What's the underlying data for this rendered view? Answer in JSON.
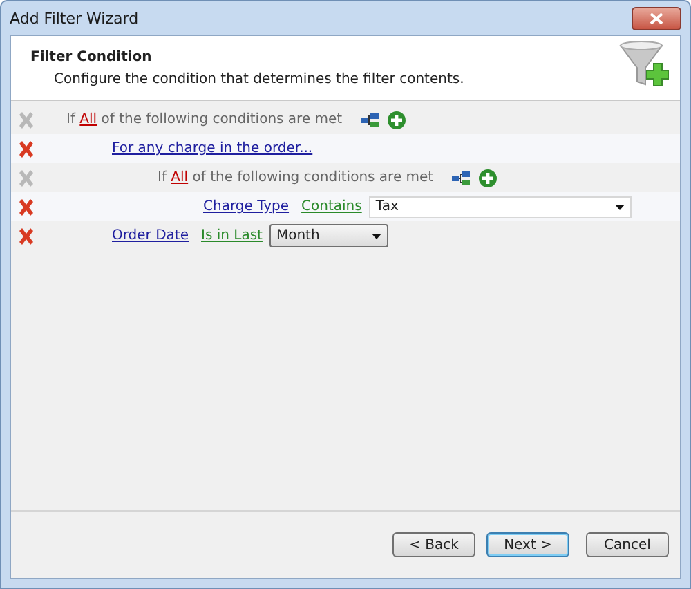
{
  "window": {
    "title": "Add Filter Wizard"
  },
  "header": {
    "title": "Filter Condition",
    "description": "Configure the condition that determines the filter contents."
  },
  "conditions": [
    {
      "kind": "group",
      "remove_disabled": true,
      "prefix": "If",
      "quantifier": "All",
      "suffix": "of the following conditions are met",
      "children": [
        {
          "kind": "link",
          "remove_disabled": false,
          "label": "For any charge in the order...",
          "children": [
            {
              "kind": "group",
              "remove_disabled": true,
              "prefix": "If",
              "quantifier": "All",
              "suffix": "of the following conditions are met",
              "children": [
                {
                  "kind": "condition",
                  "remove_disabled": false,
                  "field": "Charge Type",
                  "operator": "Contains",
                  "value": {
                    "kind": "combobox",
                    "text": "Tax"
                  }
                }
              ]
            }
          ]
        },
        {
          "kind": "condition",
          "remove_disabled": false,
          "field": "Order Date",
          "operator": "Is in Last",
          "value": {
            "kind": "dropdown",
            "text": "Month"
          }
        }
      ]
    }
  ],
  "buttons": [
    {
      "label": "< Back",
      "selected": false
    },
    {
      "label": "Next >",
      "selected": true
    },
    {
      "label": "Cancel",
      "selected": false
    }
  ]
}
